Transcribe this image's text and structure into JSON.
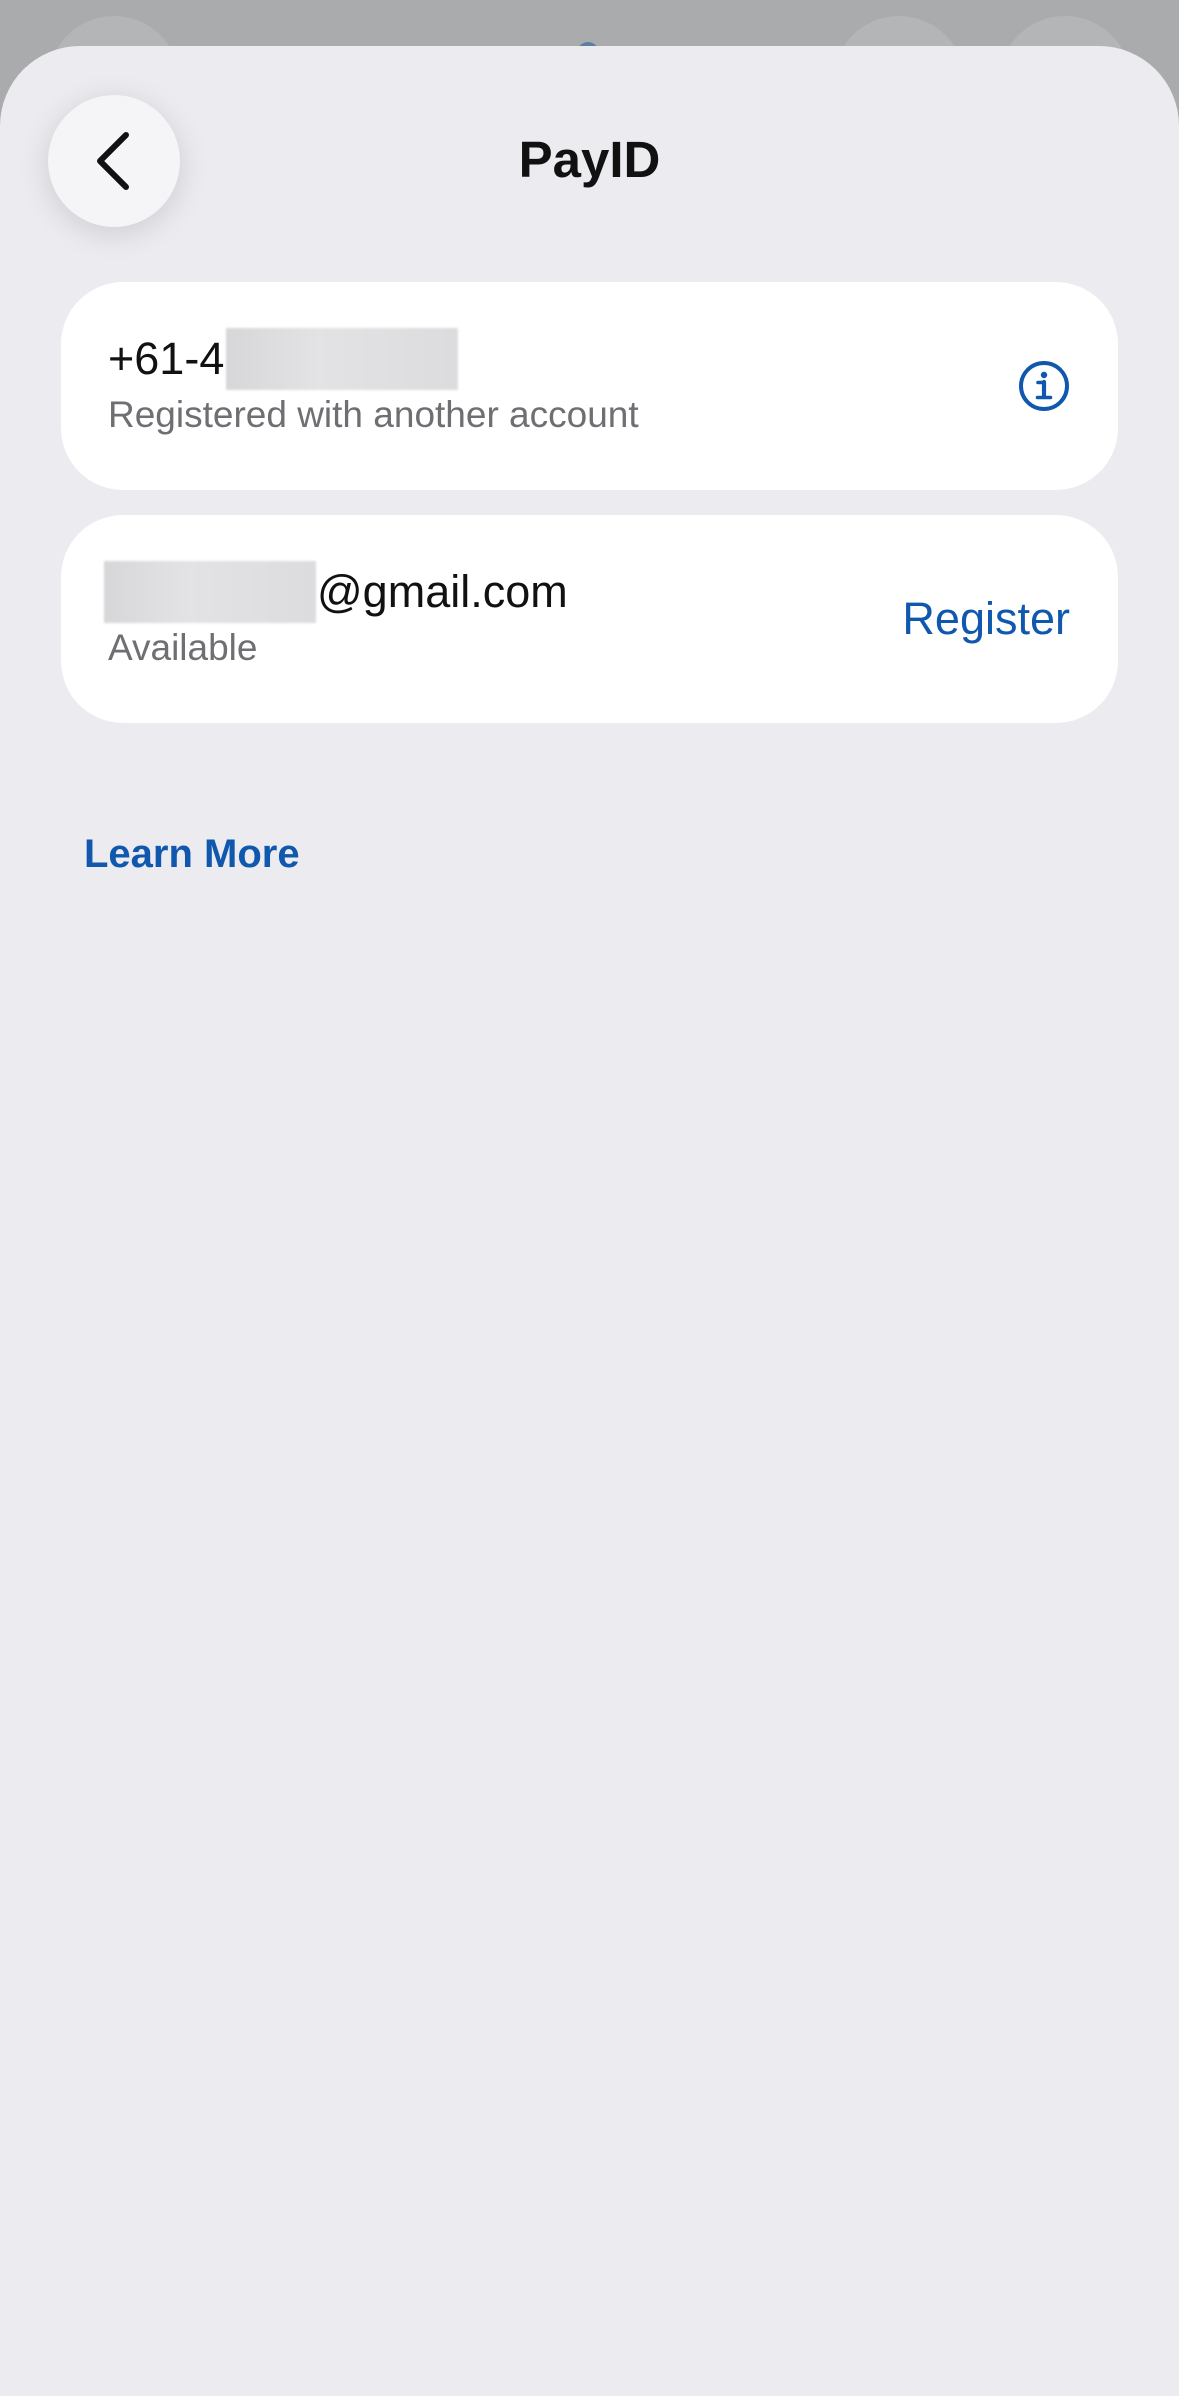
{
  "header": {
    "title": "PayID",
    "back_icon": "chevron-left-icon"
  },
  "payids": [
    {
      "value_prefix": "+61-4",
      "value_suffix": "",
      "status": "Registered with another account",
      "action_icon": "info-icon"
    },
    {
      "value_prefix": "",
      "value_suffix": "@gmail.com",
      "status": "Available",
      "action_label": "Register"
    }
  ],
  "footer": {
    "learn_more_label": "Learn More"
  },
  "colors": {
    "accent": "#1058ad",
    "background": "#ebebf0",
    "card": "#ffffff",
    "secondary_text": "#6e6e73"
  }
}
